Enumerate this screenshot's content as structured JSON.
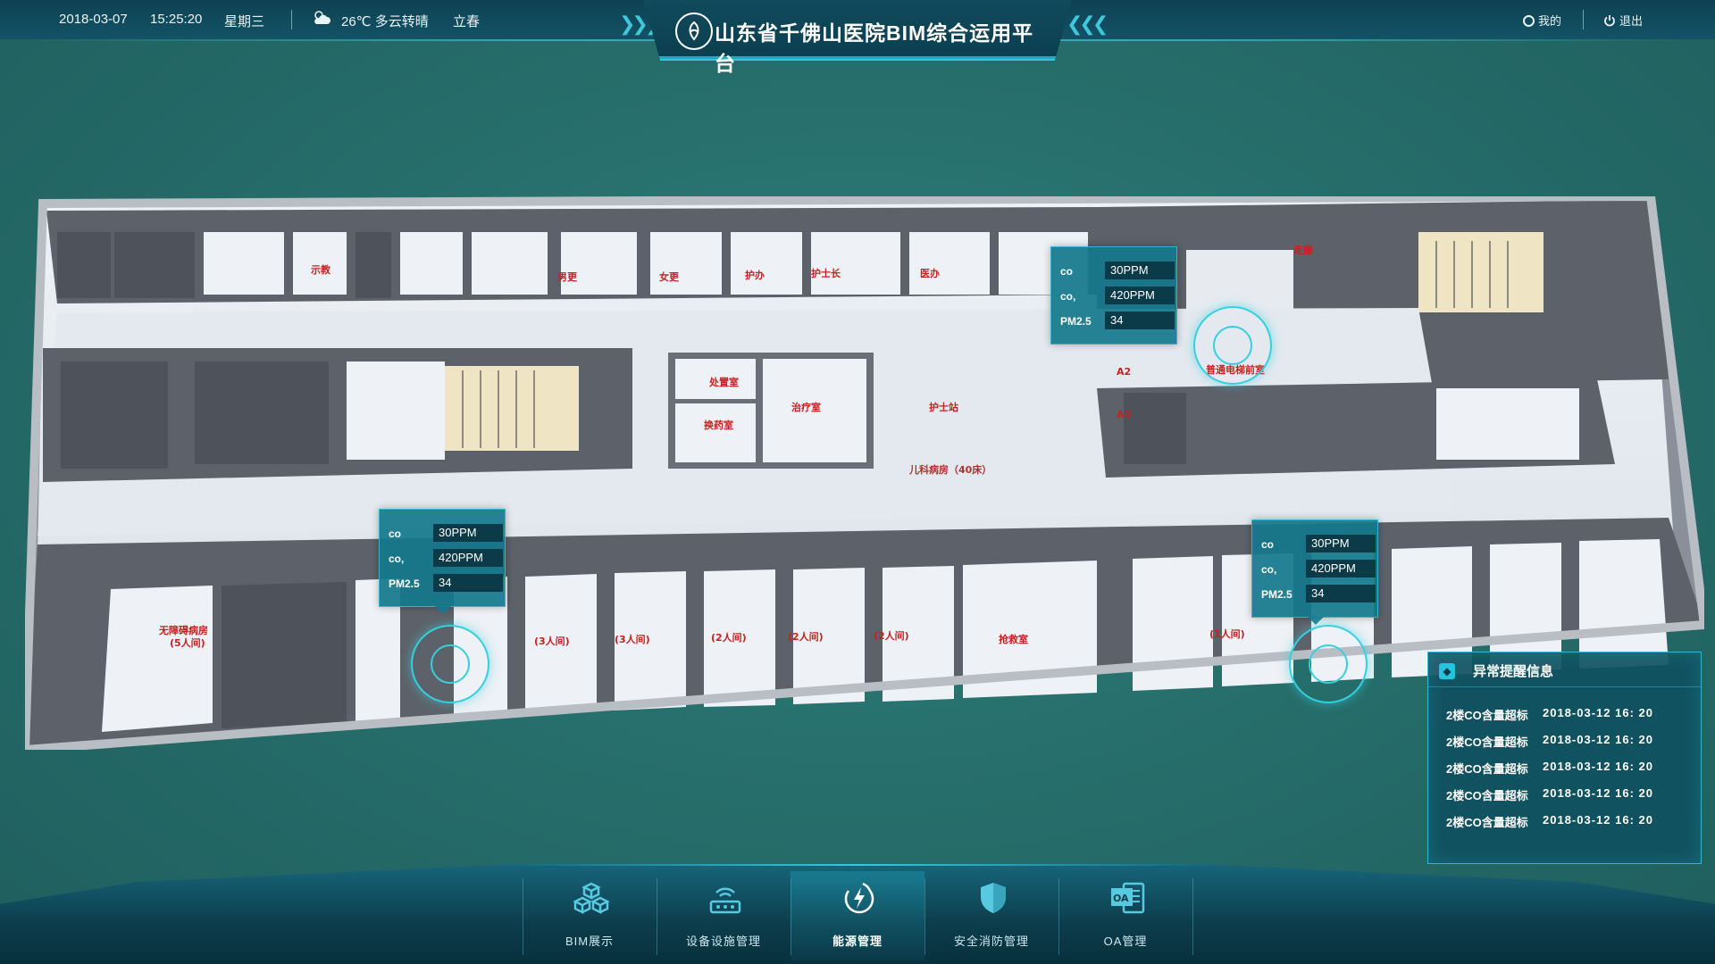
{
  "header": {
    "date": "2018-03-07",
    "time": "15:25:20",
    "weekday": "星期三",
    "weather": "26℃ 多云转晴",
    "solar_term": "立春",
    "title": "山东省千佛山医院BIM综合运用平台",
    "my_label": "我的",
    "logout_label": "退出"
  },
  "floor_plan": {
    "labels": {
      "corridor": "走廊",
      "ward": "儿科病房（40床）",
      "nurse_station": "护士站",
      "treatment_room": "治疗室",
      "disposal_room": "处置室",
      "dressing_room": "换药室",
      "elevator_lobby": "普通电梯前室",
      "rescue_room": "抢救室",
      "accessible_ward": "无障碍病房",
      "accessible_ward_beds": "(5人间)",
      "room_3": "(3人间)",
      "room_2": "(2人间)",
      "room_1": "(1人间)",
      "male_wc": "男更",
      "female_wc": "女更",
      "nurse_office": "护办",
      "head_nurse": "护士长",
      "doctor_office": "医办",
      "demo": "示教",
      "a2": "A2",
      "a3": "A3"
    }
  },
  "sensors": [
    {
      "co_label": "co",
      "co_value": "30PPM",
      "co2_label": "co,",
      "co2_value": "420PPM",
      "pm_label": "PM2.5",
      "pm_value": "34"
    },
    {
      "co_label": "co",
      "co_value": "30PPM",
      "co2_label": "co,",
      "co2_value": "420PPM",
      "pm_label": "PM2.5",
      "pm_value": "34"
    },
    {
      "co_label": "co",
      "co_value": "30PPM",
      "co2_label": "co,",
      "co2_value": "420PPM",
      "pm_label": "PM2.5",
      "pm_value": "34"
    }
  ],
  "alerts": {
    "title": "异常提醒信息",
    "items": [
      {
        "msg": "2楼CO含量超标",
        "time": "2018-03-12  16: 20"
      },
      {
        "msg": "2楼CO含量超标",
        "time": "2018-03-12  16: 20"
      },
      {
        "msg": "2楼CO含量超标",
        "time": "2018-03-12  16: 20"
      },
      {
        "msg": "2楼CO含量超标",
        "time": "2018-03-12  16: 20"
      },
      {
        "msg": "2楼CO含量超标",
        "time": "2018-03-12  16: 20"
      }
    ]
  },
  "nav": [
    {
      "label": "BIM展示",
      "icon": "cubes-icon"
    },
    {
      "label": "设备设施管理",
      "icon": "router-icon"
    },
    {
      "label": "能源管理",
      "icon": "energy-icon",
      "active": true
    },
    {
      "label": "安全消防管理",
      "icon": "shield-icon"
    },
    {
      "label": "OA管理",
      "icon": "oa-icon"
    }
  ],
  "colors": {
    "background": "#276f6c",
    "accent": "#35d0e0",
    "header": "#0e4152",
    "label_red": "#c82020"
  }
}
